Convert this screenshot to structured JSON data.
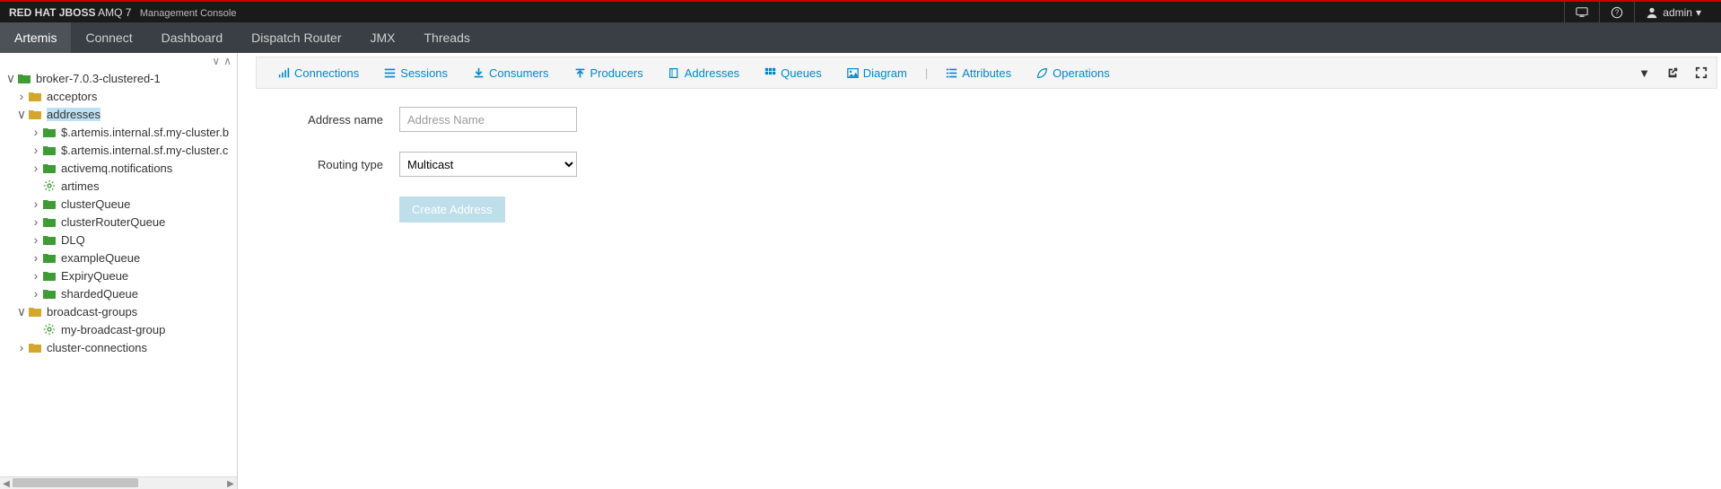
{
  "header": {
    "brand_bold": "RED HAT JBOSS",
    "brand_light": "AMQ 7",
    "brand_sub": "Management Console",
    "user": "admin"
  },
  "nav": {
    "items": [
      "Artemis",
      "Connect",
      "Dashboard",
      "Dispatch Router",
      "JMX",
      "Threads"
    ],
    "active": "Artemis"
  },
  "tree": {
    "root": "broker-7.0.3-clustered-1",
    "acceptors": "acceptors",
    "addresses": "addresses",
    "addr_items": [
      "$.artemis.internal.sf.my-cluster.b",
      "$.artemis.internal.sf.my-cluster.c",
      "activemq.notifications",
      "artimes",
      "clusterQueue",
      "clusterRouterQueue",
      "DLQ",
      "exampleQueue",
      "ExpiryQueue",
      "shardedQueue"
    ],
    "broadcast_groups": "broadcast-groups",
    "my_broadcast": "my-broadcast-group",
    "cluster_connections": "cluster-connections"
  },
  "toolbar": {
    "connections": "Connections",
    "sessions": "Sessions",
    "consumers": "Consumers",
    "producers": "Producers",
    "addresses": "Addresses",
    "queues": "Queues",
    "diagram": "Diagram",
    "attributes": "Attributes",
    "operations": "Operations"
  },
  "form": {
    "address_name_label": "Address name",
    "address_name_placeholder": "Address Name",
    "routing_type_label": "Routing type",
    "routing_type_value": "Multicast",
    "submit": "Create Address"
  }
}
